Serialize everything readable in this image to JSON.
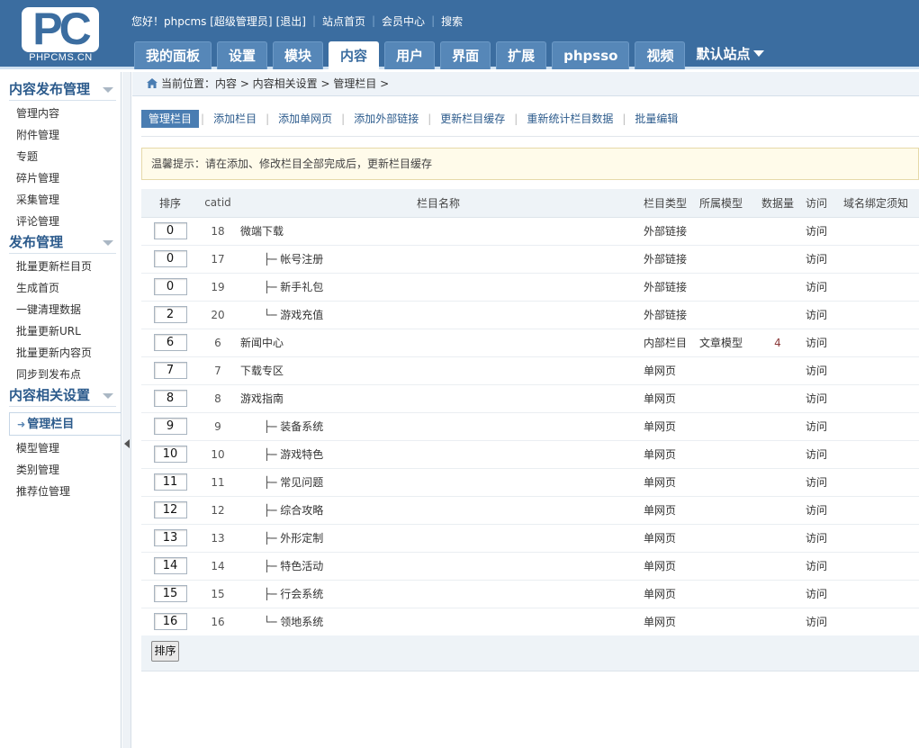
{
  "header": {
    "logo_text": "PC",
    "site_text": "PHPCMS.CN",
    "top_links": {
      "greeting": "您好！phpcms [超级管理员]",
      "logout": "[退出]",
      "home": "站点首页",
      "member": "会员中心",
      "search": "搜索"
    },
    "tabs": [
      {
        "label": "我的面板"
      },
      {
        "label": "设置"
      },
      {
        "label": "模块"
      },
      {
        "label": "内容"
      },
      {
        "label": "用户"
      },
      {
        "label": "界面"
      },
      {
        "label": "扩展"
      },
      {
        "label": "phpsso"
      },
      {
        "label": "视频"
      }
    ],
    "site_selector": "默认站点"
  },
  "sidebar": {
    "groups": [
      {
        "title": "内容发布管理",
        "items": [
          "管理内容",
          "附件管理",
          "专题",
          "碎片管理",
          "采集管理",
          "评论管理"
        ]
      },
      {
        "title": "发布管理",
        "items": [
          "批量更新栏目页",
          "生成首页",
          "一键清理数据",
          "批量更新URL",
          "批量更新内容页",
          "同步到发布点"
        ]
      },
      {
        "title": "内容相关设置",
        "items": [
          "管理栏目",
          "模型管理",
          "类别管理",
          "推荐位管理"
        ]
      }
    ]
  },
  "breadcrumb": "当前位置：内容 > 内容相关设置 > 管理栏目 >",
  "subtabs": [
    "管理栏目",
    "添加栏目",
    "添加单网页",
    "添加外部链接",
    "更新栏目缓存",
    "重新统计栏目数据",
    "批量编辑"
  ],
  "tip": "温馨提示：请在添加、修改栏目全部完成后，更新栏目缓存",
  "table": {
    "headers": {
      "sort": "排序",
      "catid": "catid",
      "name": "栏目名称",
      "type": "栏目类型",
      "model": "所属模型",
      "count": "数据量",
      "visit": "访问",
      "domain": "域名绑定须知"
    },
    "rows": [
      {
        "sort": "0",
        "catid": "18",
        "prefix": "",
        "name": "微端下载",
        "type": "外部链接",
        "type_kind": "ext",
        "model": "",
        "count": "",
        "visit": "访问"
      },
      {
        "sort": "0",
        "catid": "17",
        "prefix": "├─",
        "name": "帐号注册",
        "type": "外部链接",
        "type_kind": "ext",
        "model": "",
        "count": "",
        "visit": "访问"
      },
      {
        "sort": "0",
        "catid": "19",
        "prefix": "├─",
        "name": "新手礼包",
        "type": "外部链接",
        "type_kind": "ext",
        "model": "",
        "count": "",
        "visit": "访问"
      },
      {
        "sort": "2",
        "catid": "20",
        "prefix": "└─",
        "name": "游戏充值",
        "type": "外部链接",
        "type_kind": "ext",
        "model": "",
        "count": "",
        "visit": "访问"
      },
      {
        "sort": "6",
        "catid": "6",
        "prefix": "",
        "name": "新闻中心",
        "type": "内部栏目",
        "type_kind": "int",
        "model": "文章模型",
        "count": "4",
        "visit": "访问"
      },
      {
        "sort": "7",
        "catid": "7",
        "prefix": "",
        "name": "下载专区",
        "type": "单网页",
        "type_kind": "page",
        "model": "",
        "count": "",
        "visit": "访问"
      },
      {
        "sort": "8",
        "catid": "8",
        "prefix": "",
        "name": "游戏指南",
        "type": "单网页",
        "type_kind": "page",
        "model": "",
        "count": "",
        "visit": "访问"
      },
      {
        "sort": "9",
        "catid": "9",
        "prefix": "├─",
        "name": "装备系统",
        "type": "单网页",
        "type_kind": "page",
        "model": "",
        "count": "",
        "visit": "访问"
      },
      {
        "sort": "10",
        "catid": "10",
        "prefix": "├─",
        "name": "游戏特色",
        "type": "单网页",
        "type_kind": "page",
        "model": "",
        "count": "",
        "visit": "访问"
      },
      {
        "sort": "11",
        "catid": "11",
        "prefix": "├─",
        "name": "常见问题",
        "type": "单网页",
        "type_kind": "page",
        "model": "",
        "count": "",
        "visit": "访问"
      },
      {
        "sort": "12",
        "catid": "12",
        "prefix": "├─",
        "name": "综合攻略",
        "type": "单网页",
        "type_kind": "page",
        "model": "",
        "count": "",
        "visit": "访问"
      },
      {
        "sort": "13",
        "catid": "13",
        "prefix": "├─",
        "name": "外形定制",
        "type": "单网页",
        "type_kind": "page",
        "model": "",
        "count": "",
        "visit": "访问"
      },
      {
        "sort": "14",
        "catid": "14",
        "prefix": "├─",
        "name": "特色活动",
        "type": "单网页",
        "type_kind": "page",
        "model": "",
        "count": "",
        "visit": "访问"
      },
      {
        "sort": "15",
        "catid": "15",
        "prefix": "├─",
        "name": "行会系统",
        "type": "单网页",
        "type_kind": "page",
        "model": "",
        "count": "",
        "visit": "访问"
      },
      {
        "sort": "16",
        "catid": "16",
        "prefix": "└─",
        "name": "领地系统",
        "type": "单网页",
        "type_kind": "page",
        "model": "",
        "count": "",
        "visit": "访问"
      }
    ]
  },
  "footer": {
    "sort_button": "排序"
  }
}
